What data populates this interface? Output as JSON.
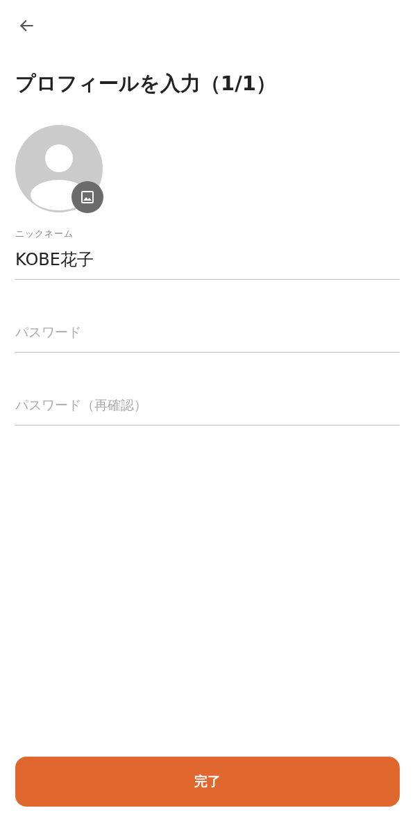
{
  "title": "プロフィールを入力（1/1）",
  "fields": [
    {
      "label": "ニックネーム",
      "value": "KOBE花子"
    },
    {
      "placeholder": "パスワード"
    },
    {
      "placeholder": "パスワード（再確認）"
    }
  ],
  "submit": "完了"
}
